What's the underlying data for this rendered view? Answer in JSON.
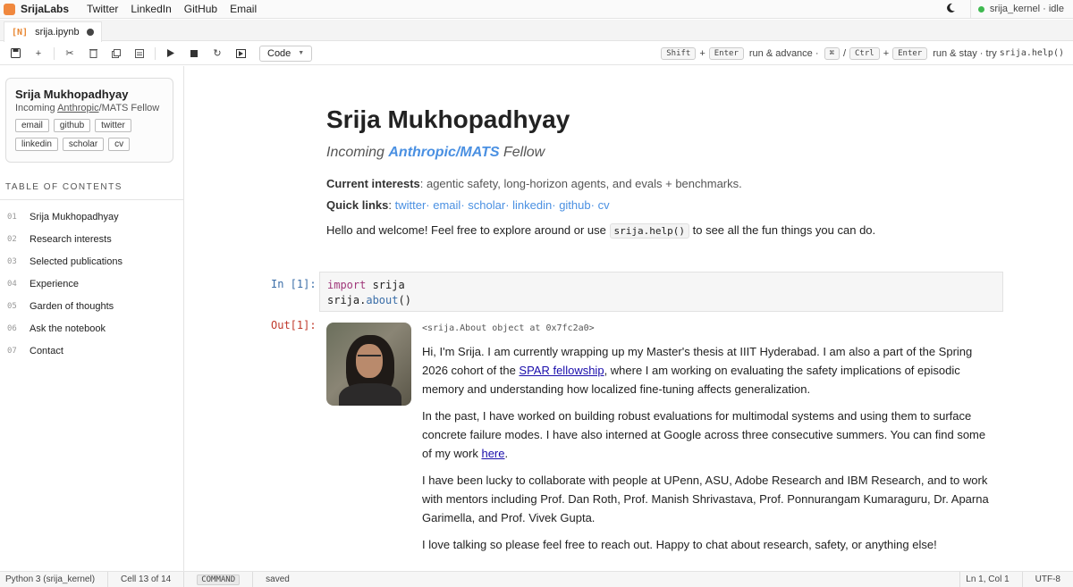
{
  "menubar": {
    "brand": "SrijaLabs",
    "items": [
      "Twitter",
      "LinkedIn",
      "GitHub",
      "Email"
    ],
    "theme_icon": "moon-icon",
    "kernel_status": "srija_kernel · idle"
  },
  "tab": {
    "icon": "[N]",
    "label": "srija.ipynb"
  },
  "toolbar": {
    "cell_type": "Code",
    "hint": {
      "key_shift": "Shift",
      "plus": "+",
      "key_enter": "Enter",
      "run_advance": "run & advance ·",
      "key_cmd": "⌘",
      "slash": "/",
      "key_ctrl": "Ctrl",
      "run_stay": "run & stay · try",
      "help_call": "srija.help()"
    }
  },
  "sidebar": {
    "name": "Srija Mukhopadhyay",
    "subtitle_pre": "Incoming ",
    "subtitle_link": "Anthropic",
    "subtitle_post": "/MATS Fellow",
    "chips": [
      "email",
      "github",
      "twitter",
      "linkedin",
      "scholar",
      "cv"
    ],
    "toc_heading": "TABLE OF CONTENTS",
    "toc": [
      {
        "num": "01",
        "label": "Srija Mukhopadhyay"
      },
      {
        "num": "02",
        "label": "Research interests"
      },
      {
        "num": "03",
        "label": "Selected publications"
      },
      {
        "num": "04",
        "label": "Experience"
      },
      {
        "num": "05",
        "label": "Garden of thoughts"
      },
      {
        "num": "06",
        "label": "Ask the notebook"
      },
      {
        "num": "07",
        "label": "Contact"
      }
    ]
  },
  "main": {
    "title": "Srija Mukhopadhyay",
    "subtitle_pre": "Incoming ",
    "subtitle_a": "Anthropic",
    "subtitle_slash": "/",
    "subtitle_b": "MATS",
    "subtitle_post": " Fellow",
    "interests_label": "Current interests",
    "interests_text": ": agentic safety, long-horizon agents, and evals + benchmarks.",
    "quick_label": "Quick links",
    "quick_colon": ": ",
    "quick_links": [
      "twitter",
      "email",
      "scholar",
      "linkedin",
      "github",
      "cv"
    ],
    "hello_pre": "Hello and welcome! Feel free to explore around or use ",
    "hello_code": "srija.help()",
    "hello_post": " to see all the fun things you can do.",
    "in_label": "In [1]:",
    "code_line1_kw": "import",
    "code_line1_rest": " srija",
    "code_line2_obj": "srija.",
    "code_line2_fn": "about",
    "code_line2_paren": "()",
    "out_label": "Out[1]:",
    "object_repr": "<srija.About object at 0x7fc2a0>",
    "bio1_a": "Hi, I'm Srija. I am currently wrapping up my Master's thesis at IIIT Hyderabad. I am also a part of the Spring 2026 cohort of the ",
    "bio1_link": "SPAR fellowship",
    "bio1_b": ", where I am working on evaluating the safety implications of episodic memory and understanding how localized fine-tuning affects generalization.",
    "bio2_a": "In the past, I have worked on building robust evaluations for multimodal systems and using them to surface concrete failure modes. I have also interned at Google across three consecutive summers. You can find some of my work ",
    "bio2_link": "here",
    "bio2_b": ".",
    "bio3": "I have been lucky to collaborate with people at UPenn, ASU, Adobe Research and IBM Research, and to work with mentors including Prof. Dan Roth, Prof. Manish Shrivastava, Prof. Ponnurangam Kumaraguru, Dr. Aparna Garimella, and Prof. Vivek Gupta.",
    "bio4": "I love talking so please feel free to reach out. Happy to chat about research, safety, or anything else!"
  },
  "statusbar": {
    "kernel": "Python 3 (srija_kernel)",
    "cell": "Cell 13 of 14",
    "mode": "COMMAND",
    "saved": "saved",
    "position": "Ln 1, Col 1",
    "encoding": "UTF-8"
  },
  "colors": {
    "accent": "#4a90e2",
    "brand": "#f0883e",
    "kernel_ok": "#3fb950",
    "out": "#c0392b",
    "in": "#3b6ea8"
  }
}
